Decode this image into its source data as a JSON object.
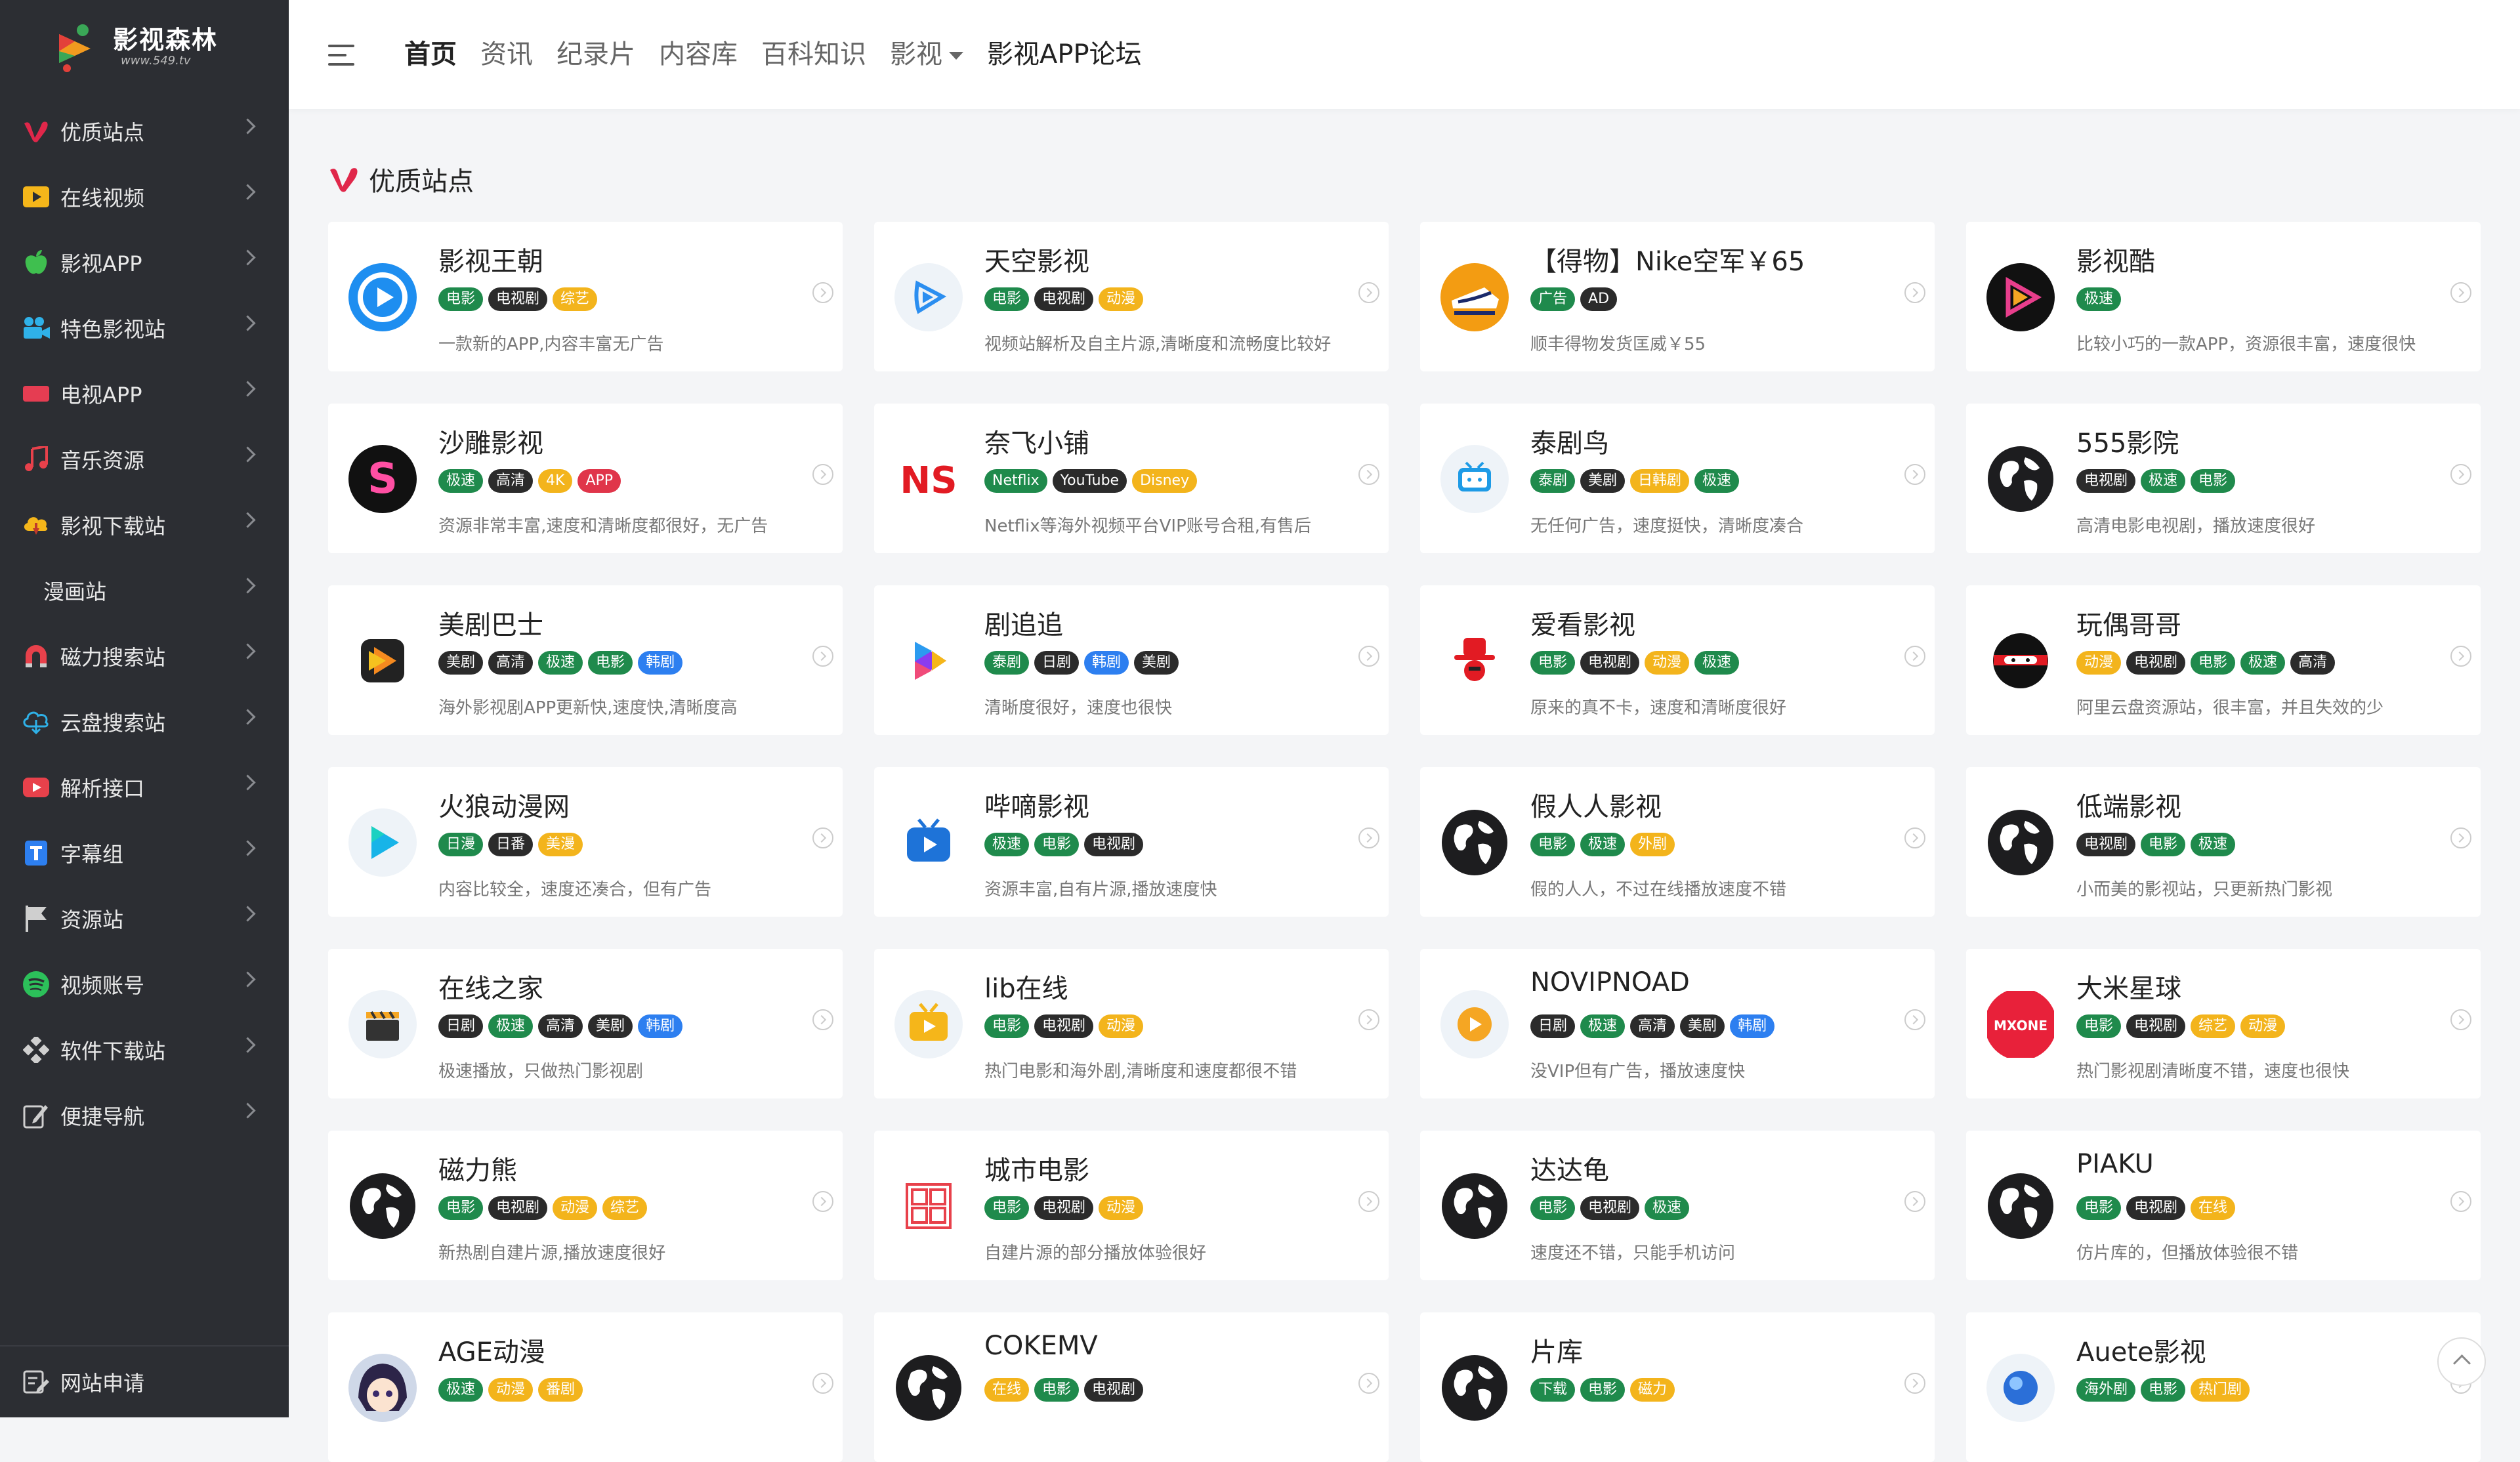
{
  "brand": {
    "title": "影视森林",
    "subtitle": "www.549.tv"
  },
  "sidebar": {
    "items": [
      {
        "label": "优质站点",
        "icon": "v-logo-icon",
        "color": "#e0274a"
      },
      {
        "label": "在线视频",
        "icon": "play-box-icon",
        "color": "#f5b61a"
      },
      {
        "label": "影视APP",
        "icon": "apple-icon",
        "color": "#3fbf4f"
      },
      {
        "label": "特色影视站",
        "icon": "film-camera-icon",
        "color": "#2fb1e8"
      },
      {
        "label": "电视APP",
        "icon": "tv-icon",
        "color": "#e53d52"
      },
      {
        "label": "音乐资源",
        "icon": "music-note-icon",
        "color": "#e8414b"
      },
      {
        "label": "影视下载站",
        "icon": "cloud-download-icon",
        "color": "#f5b61a"
      },
      {
        "label": "漫画站",
        "icon": "",
        "color": ""
      },
      {
        "label": "磁力搜索站",
        "icon": "magnet-icon",
        "color": "#e8414b"
      },
      {
        "label": "云盘搜索站",
        "icon": "cloud-icon",
        "color": "#2fb1e8"
      },
      {
        "label": "解析接口",
        "icon": "youtube-icon",
        "color": "#e8414b"
      },
      {
        "label": "字幕组",
        "icon": "text-t-icon",
        "color": "#2d7ff0"
      },
      {
        "label": "资源站",
        "icon": "flag-icon",
        "color": "#cfcfcf"
      },
      {
        "label": "视频账号",
        "icon": "spotify-icon",
        "color": "#2cc05a"
      },
      {
        "label": "软件下载站",
        "icon": "diamond-grid-icon",
        "color": "#cfcfcf"
      },
      {
        "label": "便捷导航",
        "icon": "edit-icon",
        "color": "#cfcfcf"
      }
    ],
    "bottom": {
      "label": "网站申请",
      "icon": "apply-icon"
    }
  },
  "topnav": [
    {
      "label": "首页",
      "active": true
    },
    {
      "label": "资讯"
    },
    {
      "label": "纪录片"
    },
    {
      "label": "内容库"
    },
    {
      "label": "百科知识"
    },
    {
      "label": "影视",
      "dropdown": true
    },
    {
      "label": "影视APP论坛"
    }
  ],
  "section": {
    "title": "优质站点"
  },
  "tag_colors": {
    "电影": "#1f8a4c",
    "电视剧": "#2b2b2b",
    "综艺": "#f3b41c",
    "动漫": "#f3b41c",
    "广告": "#1f8a4c",
    "AD": "#2b2b2b",
    "极速": "#1f8a4c",
    "高清": "#2b2b2b",
    "4K": "#f3b41c",
    "APP": "#e0354a",
    "Netflix": "#1f8a4c",
    "YouTube": "#2b2b2b",
    "Disney": "#f3b41c",
    "泰剧": "#1f8a4c",
    "美剧": "#2b2b2b",
    "日韩剧": "#f3b41c",
    "韩剧": "#2d7ff0",
    "日剧": "#2b2b2b",
    "日漫": "#1f8a4c",
    "日番": "#2b2b2b",
    "美漫": "#f3b41c",
    "外剧": "#f3b41c",
    "在线": "#f3b41c",
    "番剧": "#f3b41c",
    "下载": "#1f8a4c",
    "磁力": "#f3b41c",
    "海外剧": "#1f8a4c",
    "热门剧": "#f3b41c"
  },
  "sites": [
    {
      "name": "影视王朝",
      "tags": [
        "电影",
        "电视剧",
        "综艺"
      ],
      "desc": "一款新的APP,内容丰富无广告",
      "icon": "blue-play-circle-icon"
    },
    {
      "name": "天空影视",
      "tags": [
        "电影",
        "电视剧",
        "动漫"
      ],
      "desc": "视频站解析及自主片源,清晰度和流畅度比较好",
      "icon": "sky-play-icon"
    },
    {
      "name": "【得物】Nike空军￥65",
      "tags": [
        "广告",
        "AD"
      ],
      "desc": "顺丰得物发货匡威￥55",
      "icon": "nike-shoe-icon"
    },
    {
      "name": "影视酷",
      "tags": [
        "极速"
      ],
      "desc": "比较小巧的一款APP，资源很丰富，速度很快",
      "icon": "gradient-play-icon"
    },
    {
      "name": "沙雕影视",
      "tags": [
        "极速",
        "高清",
        "4K",
        "APP"
      ],
      "desc": "资源非常丰富,速度和清晰度都很好，无广告",
      "icon": "s-logo-icon"
    },
    {
      "name": "奈飞小铺",
      "tags": [
        "Netflix",
        "YouTube",
        "Disney"
      ],
      "desc": "Netflix等海外视频平台VIP账号合租,有售后",
      "icon": "ns-logo-icon"
    },
    {
      "name": "泰剧鸟",
      "tags": [
        "泰剧",
        "美剧",
        "日韩剧",
        "极速"
      ],
      "desc": "无任何广告，速度挺快，清晰度凑合",
      "icon": "tv-bird-icon"
    },
    {
      "name": "555影院",
      "tags": [
        "电视剧",
        "极速",
        "电影"
      ],
      "desc": "高清电影电视剧，播放速度很好",
      "icon": "globe-icon"
    },
    {
      "name": "美剧巴士",
      "tags": [
        "美剧",
        "高清",
        "极速",
        "电影",
        "韩剧"
      ],
      "desc": "海外影视剧APP更新快,速度快,清晰度高",
      "icon": "orange-play-icon"
    },
    {
      "name": "剧追追",
      "tags": [
        "泰剧",
        "日剧",
        "韩剧",
        "美剧"
      ],
      "desc": "清晰度很好，速度也很快",
      "icon": "colorful-play-icon"
    },
    {
      "name": "爱看影视",
      "tags": [
        "电影",
        "电视剧",
        "动漫",
        "极速"
      ],
      "desc": "原来的真不卡，速度和清晰度很好",
      "icon": "red-hat-icon"
    },
    {
      "name": "玩偶哥哥",
      "tags": [
        "动漫",
        "电视剧",
        "电影",
        "极速",
        "高清"
      ],
      "desc": "阿里云盘资源站，很丰富，并且失效的少",
      "icon": "ninja-icon"
    },
    {
      "name": "火狼动漫网",
      "tags": [
        "日漫",
        "日番",
        "美漫"
      ],
      "desc": "内容比较全，速度还凑合，但有广告",
      "icon": "cyan-play-icon"
    },
    {
      "name": "哔嘀影视",
      "tags": [
        "极速",
        "电影",
        "电视剧"
      ],
      "desc": "资源丰富,自有片源,播放速度快",
      "icon": "blue-tv-icon"
    },
    {
      "name": "假人人影视",
      "tags": [
        "电影",
        "极速",
        "外剧"
      ],
      "desc": "假的人人，不过在线播放速度不错",
      "icon": "globe-icon"
    },
    {
      "name": "低端影视",
      "tags": [
        "电视剧",
        "电影",
        "极速"
      ],
      "desc": "小而美的影视站，只更新热门影视",
      "icon": "globe-icon"
    },
    {
      "name": "在线之家",
      "tags": [
        "日剧",
        "极速",
        "高清",
        "美剧",
        "韩剧"
      ],
      "desc": "极速播放，只做热门影视剧",
      "icon": "clapper-icon"
    },
    {
      "name": "lib在线",
      "tags": [
        "电影",
        "电视剧",
        "动漫"
      ],
      "desc": "热门电影和海外剧,清晰度和速度都很不错",
      "icon": "yellow-tv-icon"
    },
    {
      "name": "NOVIPNOAD",
      "tags": [
        "日剧",
        "极速",
        "高清",
        "美剧",
        "韩剧"
      ],
      "desc": "没VIP但有广告，播放速度快",
      "icon": "orange-circle-play-icon"
    },
    {
      "name": "大米星球",
      "tags": [
        "电影",
        "电视剧",
        "综艺",
        "动漫"
      ],
      "desc": "热门影视剧清晰度不错，速度也很快",
      "icon": "mxone-icon"
    },
    {
      "name": "磁力熊",
      "tags": [
        "电影",
        "电视剧",
        "动漫",
        "综艺"
      ],
      "desc": "新热剧自建片源,播放速度很好",
      "icon": "globe-icon"
    },
    {
      "name": "城市电影",
      "tags": [
        "电影",
        "电视剧",
        "动漫"
      ],
      "desc": "自建片源的部分播放体验很好",
      "icon": "city-stamp-icon"
    },
    {
      "name": "达达龟",
      "tags": [
        "电影",
        "电视剧",
        "极速"
      ],
      "desc": "速度还不错，只能手机访问",
      "icon": "globe-icon"
    },
    {
      "name": "PIAKU",
      "tags": [
        "电影",
        "电视剧",
        "在线"
      ],
      "desc": "仿片库的，但播放体验很不错",
      "icon": "globe-icon"
    },
    {
      "name": "AGE动漫",
      "tags": [
        "极速",
        "动漫",
        "番剧"
      ],
      "desc": "",
      "icon": "anime-girl-icon"
    },
    {
      "name": "COKEMV",
      "tags": [
        "在线",
        "电影",
        "电视剧"
      ],
      "desc": "",
      "icon": "globe-icon"
    },
    {
      "name": "片库",
      "tags": [
        "下载",
        "电影",
        "磁力"
      ],
      "desc": "",
      "icon": "globe-icon"
    },
    {
      "name": "Auete影视",
      "tags": [
        "海外剧",
        "电影",
        "热门剧"
      ],
      "desc": "",
      "icon": "blue-orb-icon"
    }
  ]
}
